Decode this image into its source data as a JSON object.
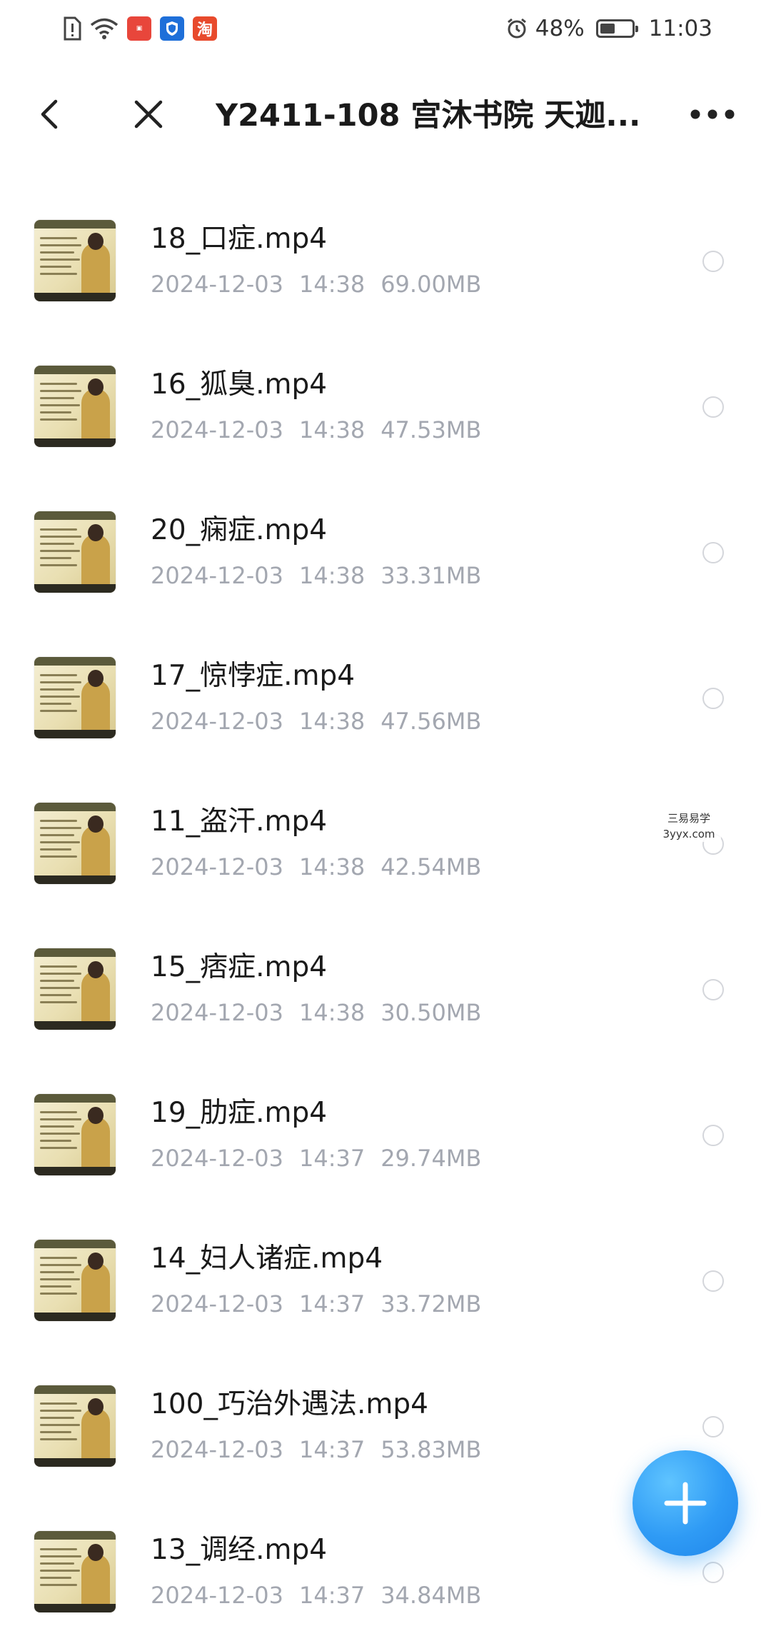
{
  "status_bar": {
    "icons": [
      "sim-alert-icon",
      "wifi-icon",
      "app-notification-red",
      "shield-app-icon",
      "taobao-icon"
    ],
    "taobao_glyph": "淘",
    "alarm_icon": "alarm-icon",
    "battery_percent_label": "48%",
    "battery_level": 0.48,
    "time": "11:03"
  },
  "title_bar": {
    "back_icon": "chevron-left-icon",
    "close_icon": "close-icon",
    "title": "Y2411-108 宫沐书院 天迦...",
    "more_icon": "more-horizontal-icon"
  },
  "files": [
    {
      "name": "18_口症.mp4",
      "date": "2024-12-03",
      "time": "14:38",
      "size": "69.00MB"
    },
    {
      "name": "16_狐臭.mp4",
      "date": "2024-12-03",
      "time": "14:38",
      "size": "47.53MB"
    },
    {
      "name": "20_痫症.mp4",
      "date": "2024-12-03",
      "time": "14:38",
      "size": "33.31MB"
    },
    {
      "name": "17_惊悖症.mp4",
      "date": "2024-12-03",
      "time": "14:38",
      "size": "47.56MB"
    },
    {
      "name": "11_盗汗.mp4",
      "date": "2024-12-03",
      "time": "14:38",
      "size": "42.54MB"
    },
    {
      "name": "15_痞症.mp4",
      "date": "2024-12-03",
      "time": "14:38",
      "size": "30.50MB"
    },
    {
      "name": "19_肋症.mp4",
      "date": "2024-12-03",
      "time": "14:37",
      "size": "29.74MB"
    },
    {
      "name": "14_妇人诸症.mp4",
      "date": "2024-12-03",
      "time": "14:37",
      "size": "33.72MB"
    },
    {
      "name": "100_巧治外遇法.mp4",
      "date": "2024-12-03",
      "time": "14:37",
      "size": "53.83MB"
    },
    {
      "name": "13_调经.mp4",
      "date": "2024-12-03",
      "time": "14:37",
      "size": "34.84MB"
    }
  ],
  "watermark": {
    "line1": "三易易学",
    "line2": "3yyx.com"
  },
  "fab": {
    "icon": "plus-icon"
  },
  "colors": {
    "fab": "#2f9bf5",
    "meta_text": "#a3a7b0",
    "title_text": "#1a1a1a"
  }
}
